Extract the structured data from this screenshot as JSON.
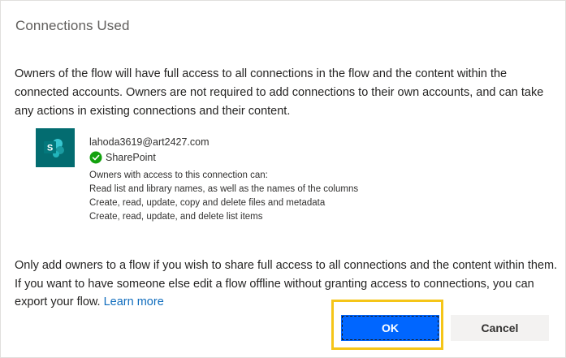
{
  "dialog": {
    "title": "Connections Used",
    "intro_text": "Owners of the flow will have full access to all connections in the flow and the content within the connected accounts. Owners are not required to add connections to their own accounts, and can take any actions in existing connections and their content."
  },
  "connection": {
    "icon": "sharepoint-icon",
    "account": "lahoda3619@art2427.com",
    "status_icon": "check-circle-icon",
    "status_color": "#13a10e",
    "service_name": "SharePoint",
    "icon_color": "#036c70",
    "permissions_heading": "Owners with access to this connection can:",
    "permissions": [
      "Read list and library names, as well as the names of the columns",
      "Create, read, update, copy and delete files and metadata",
      "Create, read, update, and delete list items"
    ]
  },
  "footer": {
    "text": "Only add owners to a flow if you wish to share full access to all connections and the content within them. If you want to have someone else edit a flow offline without granting access to connections, you can export your flow.",
    "link_label": "Learn more"
  },
  "buttons": {
    "ok_label": "OK",
    "cancel_label": "Cancel",
    "ok_color": "#0066ff",
    "highlight_color": "#f5c518"
  }
}
